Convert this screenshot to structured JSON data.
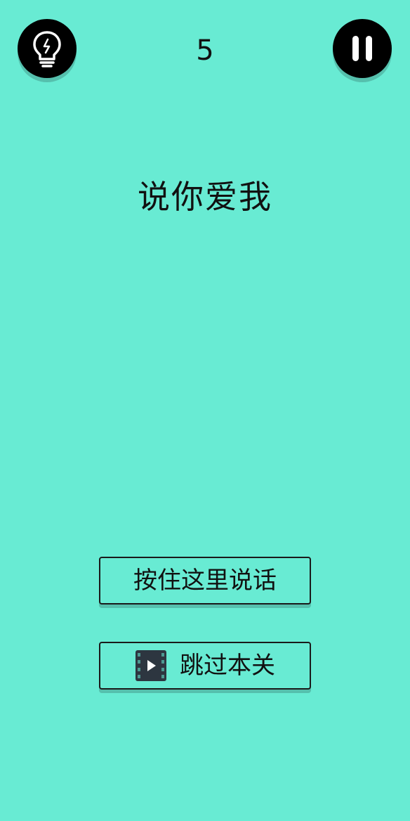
{
  "theme": {
    "background": "#68EBD3",
    "button_fill": "#000000",
    "button_icon": "#FFFFFF",
    "card_fill": "#68EBD3",
    "text": "#111111"
  },
  "header": {
    "level": "5",
    "hint_icon": "lightbulb-icon",
    "pause_icon": "pause-icon"
  },
  "prompt": {
    "text": "说你爱我"
  },
  "actions": {
    "speak_label": "按住这里说话",
    "skip_label": "跳过本关",
    "skip_icon": "video-play-icon"
  }
}
